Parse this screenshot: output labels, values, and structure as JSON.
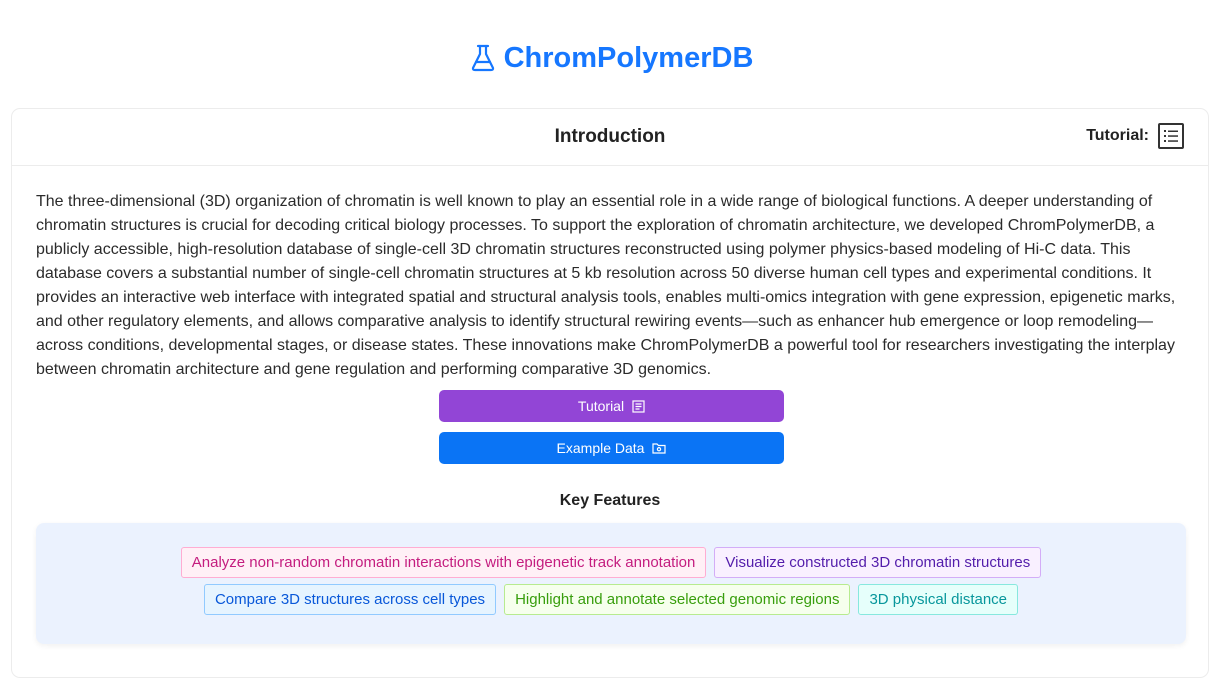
{
  "header": {
    "title": "ChromPolymerDB",
    "icon": "flask-icon",
    "color": "#1677ff"
  },
  "card": {
    "title": "Introduction",
    "tutorial_label": "Tutorial:",
    "tutorial_icon": "list-icon",
    "intro_text": "The three-dimensional (3D) organization of chromatin is well known to play an essential role in a wide range of biological functions. A deeper understanding of chromatin structures is crucial for decoding critical biology processes. To support the exploration of chromatin architecture, we developed ChromPolymerDB, a publicly accessible, high-resolution database of single-cell 3D chromatin structures reconstructed using polymer physics-based modeling of Hi-C data. This database covers a substantial number of single-cell chromatin structures at 5 kb resolution across 50 diverse human cell types and experimental conditions. It provides an interactive web interface with integrated spatial and structural analysis tools, enables multi-omics integration with gene expression, epigenetic marks, and other regulatory elements, and allows comparative analysis to identify structural rewiring events—such as enhancer hub emergence or loop remodeling—across conditions, developmental stages, or disease states. These innovations make ChromPolymerDB a powerful tool for researchers investigating the interplay between chromatin architecture and gene regulation and performing comparative 3D genomics."
  },
  "buttons": {
    "tutorial": {
      "label": "Tutorial",
      "icon": "file-text-icon",
      "color": "#9245d6"
    },
    "example": {
      "label": "Example Data",
      "icon": "folder-icon",
      "color": "#0a74f5"
    }
  },
  "features": {
    "title": "Key Features",
    "tags": [
      {
        "label": "Analyze non-random chromatin interactions with epigenetic track annotation",
        "color": "#c41d7f"
      },
      {
        "label": "Visualize constructed 3D chromatin structures",
        "color": "#531dab"
      },
      {
        "label": "Compare 3D structures across cell types",
        "color": "#0958d9"
      },
      {
        "label": "Highlight and annotate selected genomic regions",
        "color": "#389e0d"
      },
      {
        "label": "3D physical distance",
        "color": "#08979c"
      }
    ]
  }
}
